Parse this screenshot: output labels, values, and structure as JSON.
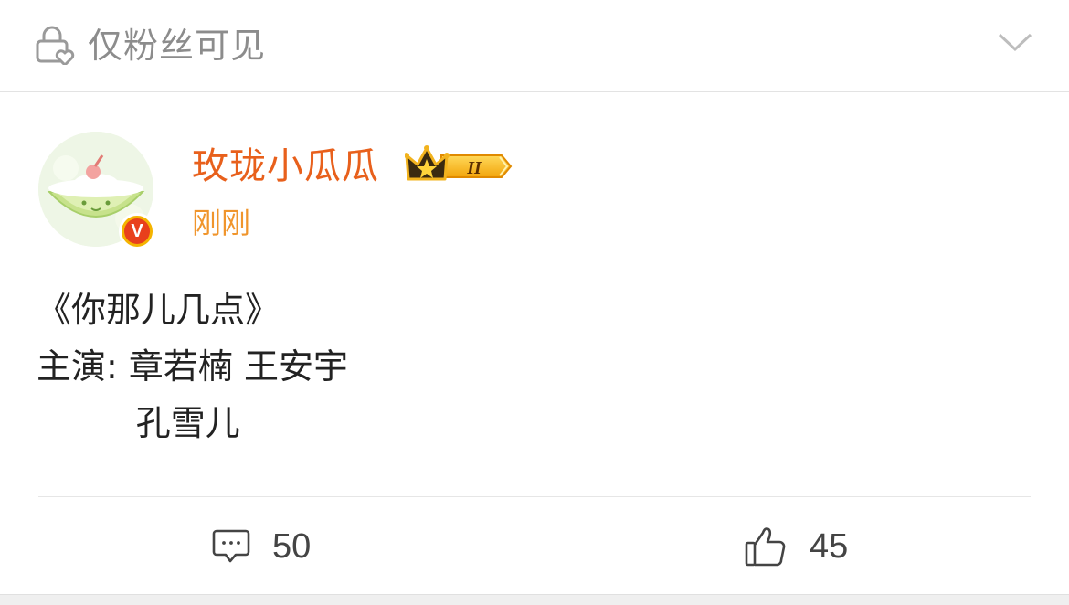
{
  "header": {
    "visibility_label": "仅粉丝可见",
    "lock_icon": "lock-heart-icon",
    "expand_icon": "chevron-down-icon"
  },
  "post": {
    "author": {
      "name": "玫珑小瓜瓜",
      "avatar_icon": "melon-avatar",
      "verified_badge": "V",
      "vip_level": "II"
    },
    "time": "刚刚",
    "content": {
      "line1": "《你那儿几点》",
      "line2": "主演: 章若楠 王安宇",
      "line3": "         孔雪儿"
    },
    "actions": {
      "comment_count": "50",
      "like_count": "45"
    }
  },
  "colors": {
    "username": "#e8601c",
    "time": "#f0952c",
    "muted": "#8c8c8c",
    "badge_red": "#e8401c",
    "badge_gold": "#f4b400"
  }
}
